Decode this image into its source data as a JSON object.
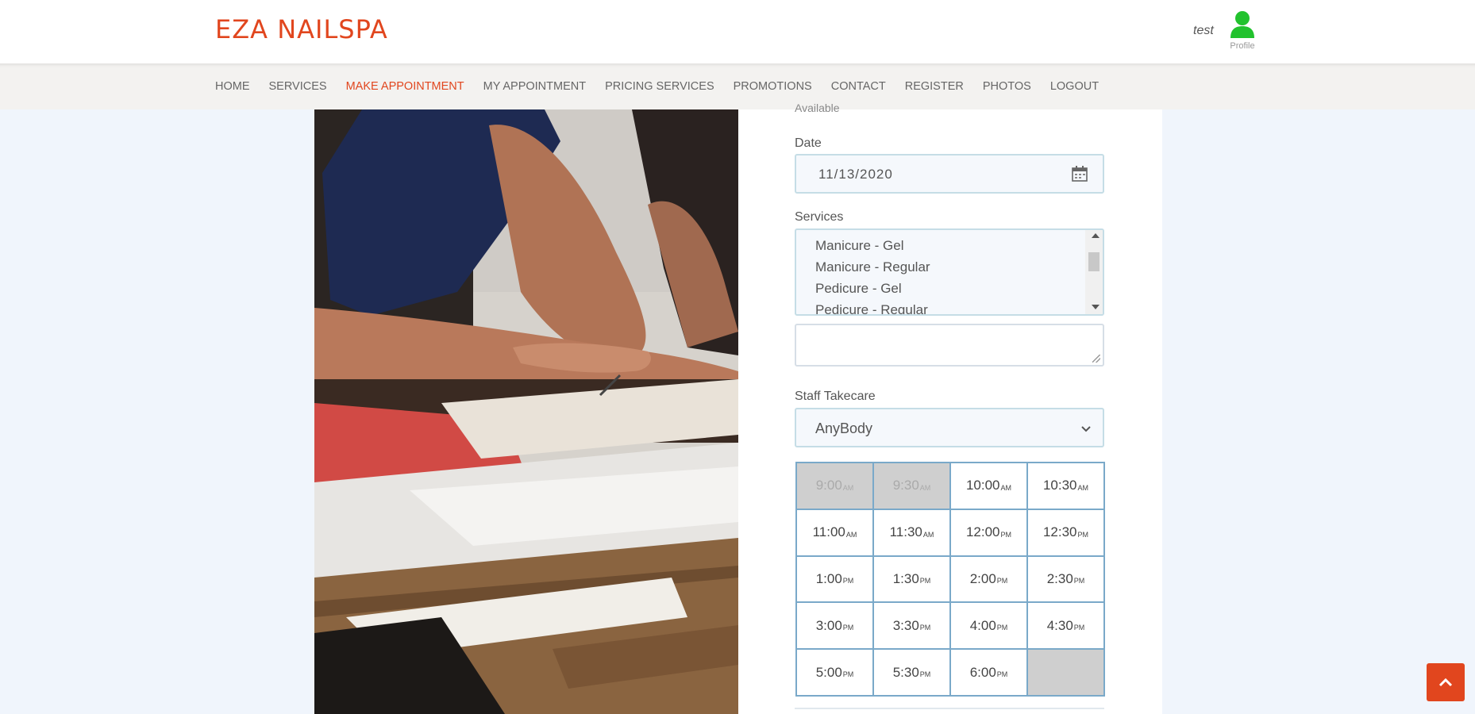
{
  "brand": "EZA NAILSPA",
  "user": {
    "name": "test",
    "profile_label": "Profile"
  },
  "nav": [
    {
      "label": "HOME",
      "active": false
    },
    {
      "label": "SERVICES",
      "active": false
    },
    {
      "label": "MAKE APPOINTMENT",
      "active": true
    },
    {
      "label": "MY APPOINTMENT",
      "active": false
    },
    {
      "label": "PRICING SERVICES",
      "active": false
    },
    {
      "label": "PROMOTIONS",
      "active": false
    },
    {
      "label": "CONTACT",
      "active": false
    },
    {
      "label": "REGISTER",
      "active": false
    },
    {
      "label": "PHOTOS",
      "active": false
    },
    {
      "label": "LOGOUT",
      "active": false
    }
  ],
  "form": {
    "radio_partial": "Available",
    "date_label": "Date",
    "date_value": "11/13/2020",
    "services_label": "Services",
    "services_options": [
      "Manicure - Gel",
      "Manicure - Regular",
      "Pedicure - Gel",
      "Pedicure - Regular"
    ],
    "note_value": "",
    "staff_label": "Staff Takecare",
    "staff_value": "AnyBody"
  },
  "time_slots": [
    {
      "time": "9:00",
      "ampm": "AM",
      "disabled": true
    },
    {
      "time": "9:30",
      "ampm": "AM",
      "disabled": true
    },
    {
      "time": "10:00",
      "ampm": "AM",
      "disabled": false
    },
    {
      "time": "10:30",
      "ampm": "AM",
      "disabled": false
    },
    {
      "time": "11:00",
      "ampm": "AM",
      "disabled": false
    },
    {
      "time": "11:30",
      "ampm": "AM",
      "disabled": false
    },
    {
      "time": "12:00",
      "ampm": "PM",
      "disabled": false
    },
    {
      "time": "12:30",
      "ampm": "PM",
      "disabled": false
    },
    {
      "time": "1:00",
      "ampm": "PM",
      "disabled": false
    },
    {
      "time": "1:30",
      "ampm": "PM",
      "disabled": false
    },
    {
      "time": "2:00",
      "ampm": "PM",
      "disabled": false
    },
    {
      "time": "2:30",
      "ampm": "PM",
      "disabled": false
    },
    {
      "time": "3:00",
      "ampm": "PM",
      "disabled": false
    },
    {
      "time": "3:30",
      "ampm": "PM",
      "disabled": false
    },
    {
      "time": "4:00",
      "ampm": "PM",
      "disabled": false
    },
    {
      "time": "4:30",
      "ampm": "PM",
      "disabled": false
    },
    {
      "time": "5:00",
      "ampm": "PM",
      "disabled": false
    },
    {
      "time": "5:30",
      "ampm": "PM",
      "disabled": false
    },
    {
      "time": "6:00",
      "ampm": "PM",
      "disabled": false
    },
    {
      "time": "",
      "ampm": "",
      "disabled": true
    }
  ],
  "colors": {
    "accent": "#e1461e",
    "profile_icon": "#22c22e",
    "slot_border": "#7aa9c9",
    "field_border": "#c5dde6"
  },
  "icons": {
    "profile": "user-icon",
    "calendar": "calendar-icon",
    "chevron": "chevron-down-icon",
    "back_to_top": "chevron-up-icon"
  }
}
